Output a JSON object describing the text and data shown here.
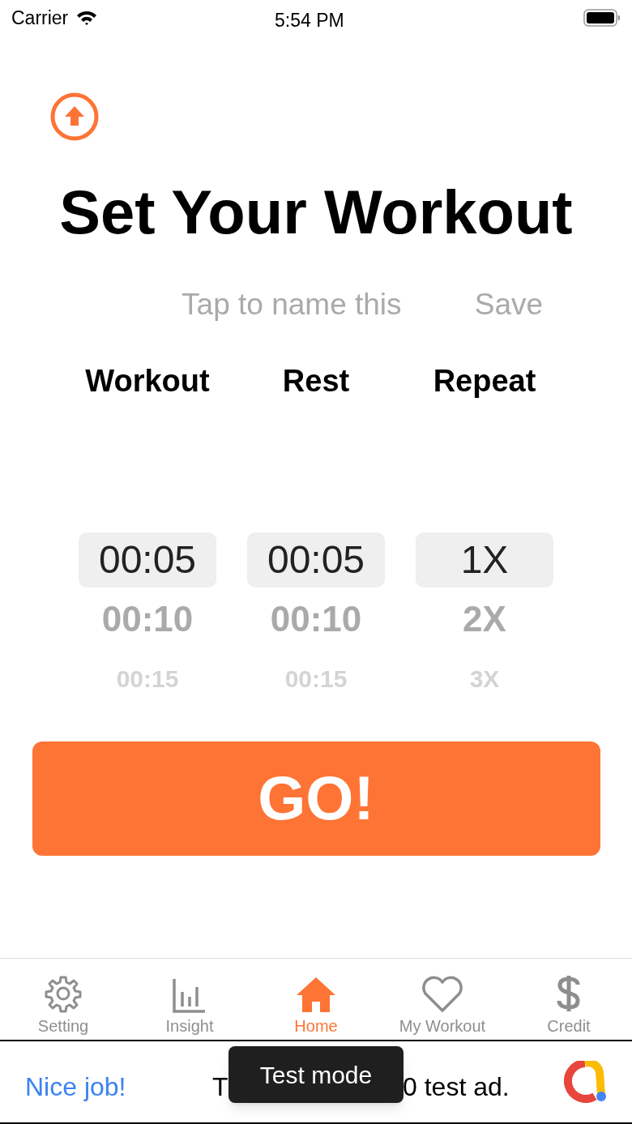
{
  "status_bar": {
    "carrier": "Carrier",
    "time": "5:54 PM"
  },
  "title": "Set Your Workout",
  "name_field": {
    "placeholder": "Tap to name this"
  },
  "save_button": "Save",
  "pickers": [
    {
      "heading": "Workout",
      "items": [
        {
          "label": "00:05",
          "selected": true
        },
        {
          "label": "00:10",
          "selected": false
        },
        {
          "label": "00:15",
          "selected": false
        }
      ]
    },
    {
      "heading": "Rest",
      "items": [
        {
          "label": "00:05",
          "selected": true
        },
        {
          "label": "00:10",
          "selected": false
        },
        {
          "label": "00:15",
          "selected": false
        }
      ]
    },
    {
      "heading": "Repeat",
      "items": [
        {
          "label": "1X",
          "selected": true
        },
        {
          "label": "2X",
          "selected": false
        },
        {
          "label": "3X",
          "selected": false
        }
      ]
    }
  ],
  "go_button": "GO!",
  "tab_bar": [
    {
      "label": "Setting",
      "selected": false
    },
    {
      "label": "Insight",
      "selected": false
    },
    {
      "label": "Home",
      "selected": true
    },
    {
      "label": "My Workout",
      "selected": false
    },
    {
      "label": "Credit",
      "selected": false
    }
  ],
  "ad_banner": {
    "headline": "Nice job!",
    "text_left": "T",
    "text_right": "0 test ad.",
    "toast": "Test mode"
  }
}
